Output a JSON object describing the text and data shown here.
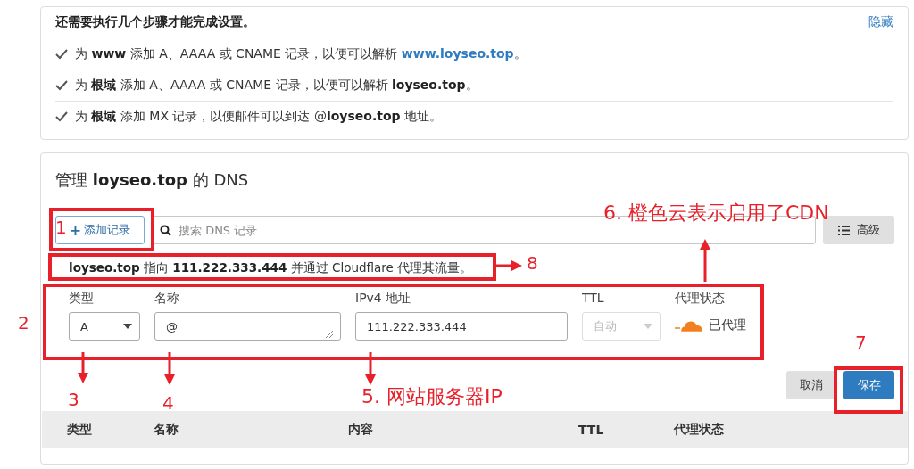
{
  "setup": {
    "title": "还需要执行几个步骤才能完成设置。",
    "hide_link": "隐藏",
    "steps": [
      {
        "text": "为 **www** 添加 A、AAAA 或 CNAME 记录，以便可以解析 ",
        "link": "www.loyseo.top",
        "suffix": "。"
      },
      {
        "text": "为 **根域** 添加 A、AAAA 或 CNAME 记录，以便可以解析 **loyseo.top**。"
      },
      {
        "text": "为 **根域** 添加 MX 记录，以便邮件可以到达 @**loyseo.top** 地址。"
      }
    ]
  },
  "dns": {
    "title": "管理 **loyseo.top** 的 DNS",
    "add_button": "添加记录",
    "add_icon": "+",
    "search": {
      "placeholder": "搜索 DNS 记录"
    },
    "advanced_button": "高级",
    "info": "**loyseo.top** 指向 **111.222.333.444** 并通过 Cloudflare 代理其流量。",
    "form": [
      {
        "kind": "select",
        "label": "类型",
        "value": "A",
        "disabled": false
      },
      {
        "kind": "textarea",
        "label": "名称",
        "value": "@"
      },
      {
        "kind": "input",
        "label": "IPv4 地址",
        "value": "111.222.333.444"
      },
      {
        "kind": "select",
        "label": "TTL",
        "value": "自动",
        "disabled": true
      },
      {
        "kind": "proxy",
        "label": "代理状态",
        "value": "已代理",
        "proxied": true
      }
    ],
    "cancel_button": "取消",
    "save_button": "保存",
    "columns": [
      "类型",
      "名称",
      "内容",
      "TTL",
      "代理状态"
    ]
  },
  "annotations": [
    "1",
    "2",
    "3",
    "4",
    "5. 网站服务器IP",
    "6. 橙色云表示启用了CDN",
    "7",
    "8"
  ]
}
